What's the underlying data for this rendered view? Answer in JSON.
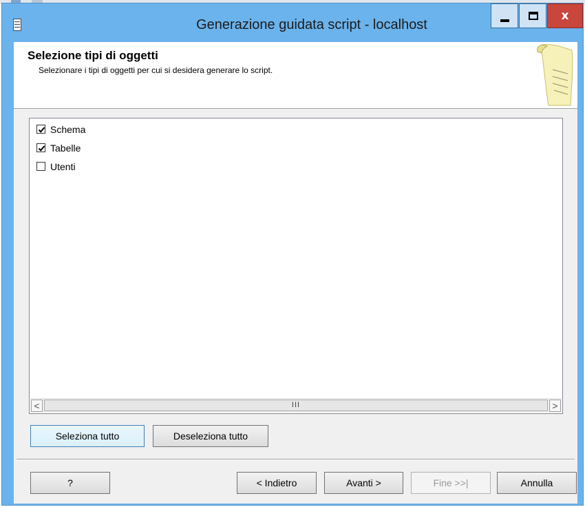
{
  "window": {
    "title": "Generazione guidata script - localhost",
    "minimize_glyph": "_",
    "maximize_glyph": "□",
    "close_glyph": "x"
  },
  "header": {
    "title": "Selezione tipi di oggetti",
    "subtitle": "Selezionare i tipi di oggetti per cui si desidera generare lo script.",
    "icon": "script-scroll-icon"
  },
  "object_types": [
    {
      "label": "Schema",
      "checked": true
    },
    {
      "label": "Tabelle",
      "checked": true
    },
    {
      "label": "Utenti",
      "checked": false
    }
  ],
  "scrollbar": {
    "left_arrow": "<",
    "right_arrow": ">",
    "thumb_grip": "III"
  },
  "selection_buttons": {
    "select_all": "Seleziona tutto",
    "deselect_all": "Deseleziona tutto"
  },
  "nav_buttons": {
    "help": "?",
    "back": "< Indietro",
    "next": "Avanti >",
    "finish": "Fine >>|",
    "cancel": "Annulla"
  },
  "colors": {
    "frame": "#6bb3ec",
    "close_button": "#c9463d",
    "client": "#f0f0f0"
  }
}
